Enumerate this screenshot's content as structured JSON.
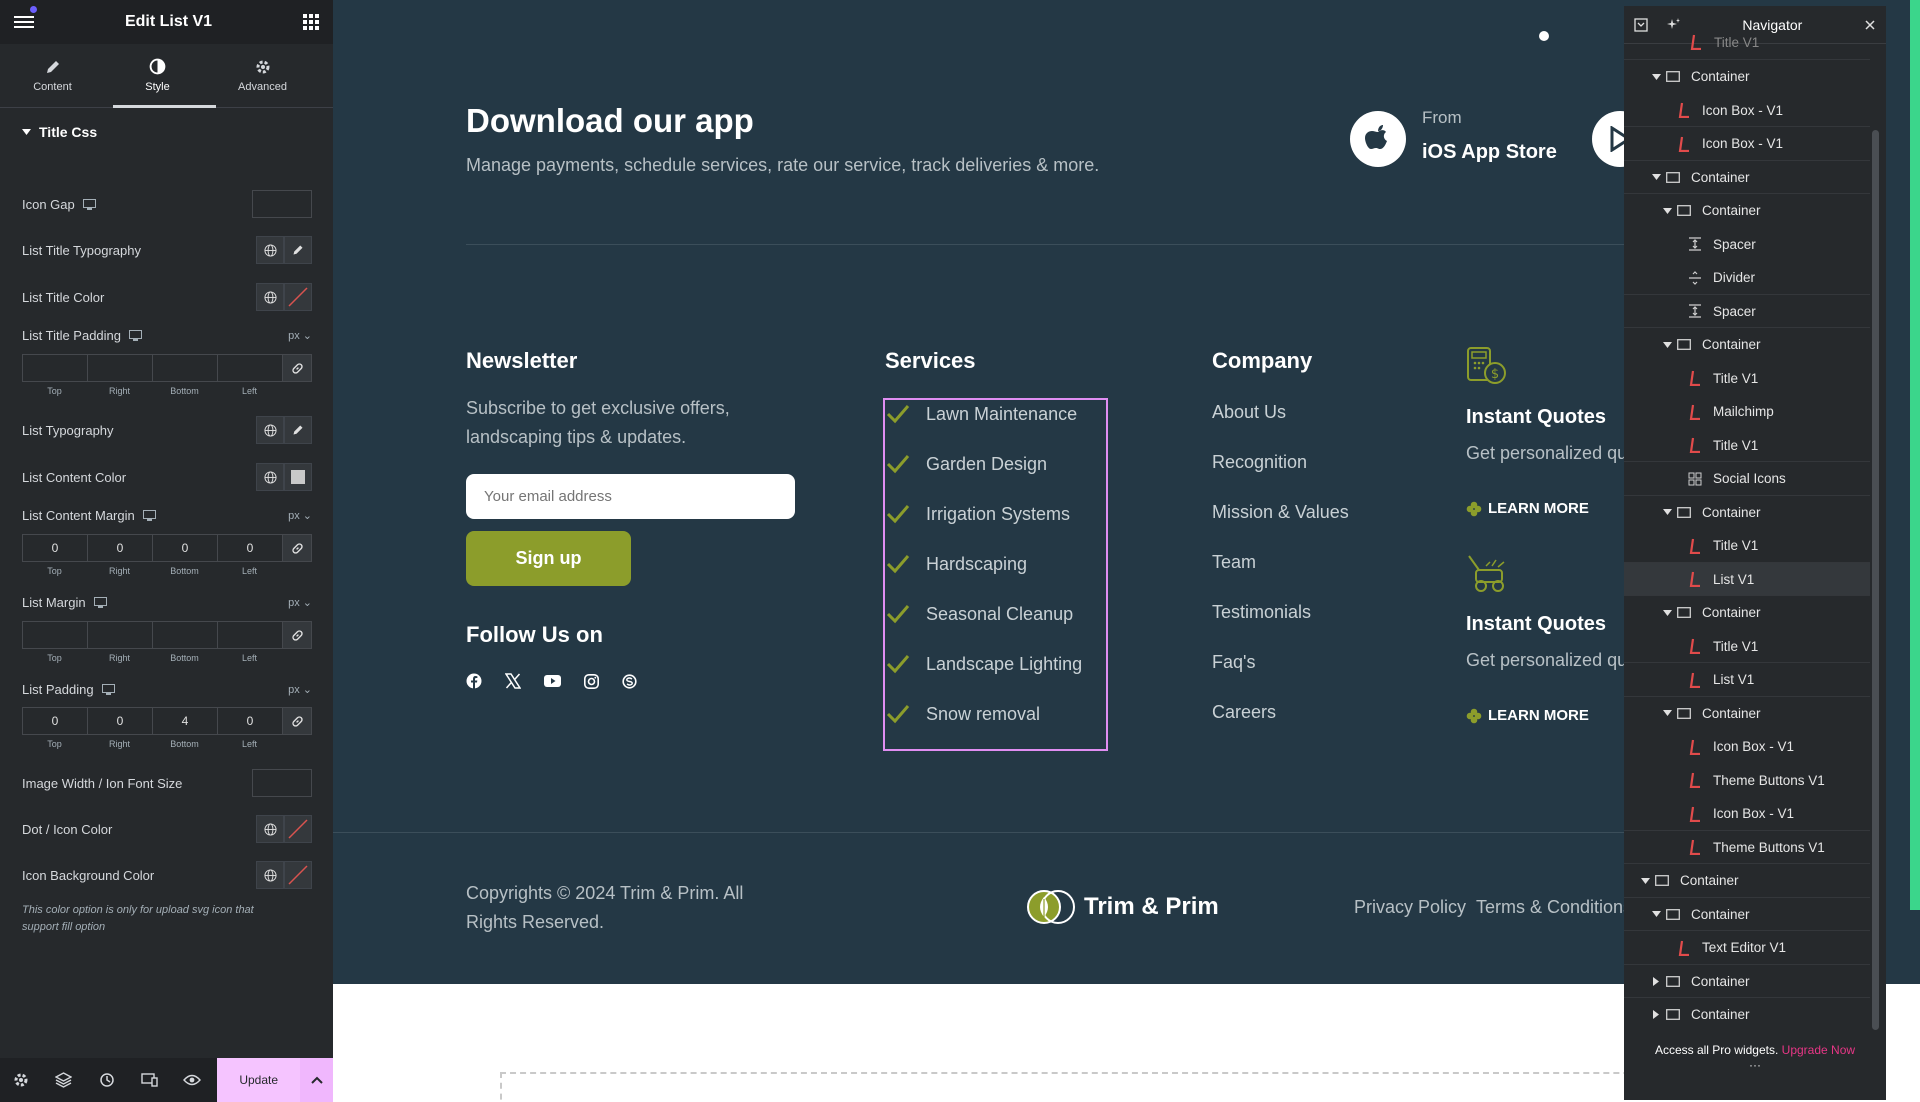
{
  "editor": {
    "title": "Edit List V1",
    "tabs": [
      {
        "label": "Content",
        "icon": "pencil-icon"
      },
      {
        "label": "Style",
        "icon": "contrast-icon"
      },
      {
        "label": "Advanced",
        "icon": "gear-icon"
      }
    ],
    "section_title": "Title Css",
    "controls": {
      "icon_gap": "Icon Gap",
      "list_title_typography": "List Title Typography",
      "list_title_color": "List Title Color",
      "list_title_padding": "List Title Padding",
      "list_typography": "List Typography",
      "list_content_color": "List Content Color",
      "list_content_margin": "List Content Margin",
      "list_margin": "List Margin",
      "list_padding": "List Padding",
      "image_width": "Image Width / Ion Font Size",
      "dot_icon_color": "Dot / Icon Color",
      "icon_bg_color": "Icon Background Color"
    },
    "unit": "px",
    "dim_labels": [
      "Top",
      "Right",
      "Bottom",
      "Left"
    ],
    "title_padding_values": [
      "",
      "",
      "",
      ""
    ],
    "content_margin_values": [
      "0",
      "0",
      "0",
      "0"
    ],
    "list_margin_values": [
      "",
      "",
      "",
      ""
    ],
    "list_padding_values": [
      "0",
      "0",
      "4",
      "0"
    ],
    "note": "This color option is only for upload svg icon that support fill option",
    "update_label": "Update"
  },
  "site": {
    "app": {
      "title": "Download our app",
      "subtitle": "Manage payments, schedule services, rate our service, track deliveries & more.",
      "store_from": "From",
      "store_name": "iOS App Store"
    },
    "newsletter": {
      "title": "Newsletter",
      "text": "Subscribe to get exclusive offers, landscaping tips & updates.",
      "placeholder": "Your email address",
      "button": "Sign up",
      "follow": "Follow Us on"
    },
    "services": {
      "title": "Services",
      "items": [
        "Lawn Maintenance",
        "Garden Design",
        "Irrigation Systems",
        "Hardscaping",
        "Seasonal Cleanup",
        "Landscape Lighting",
        "Snow removal"
      ]
    },
    "company": {
      "title": "Company",
      "items": [
        "About Us",
        "Recognition",
        "Mission & Values",
        "Team",
        "Testimonials",
        "Faq's",
        "Careers"
      ]
    },
    "quotes": [
      {
        "title": "Instant Quotes",
        "text": "Get personalized qu",
        "link": "LEARN MORE"
      },
      {
        "title": "Instant Quotes",
        "text": "Get personalized qu",
        "link": "LEARN MORE"
      }
    ],
    "footer": {
      "copyright": "Copyrights © 2024 Trim & Prim. All Rights Reserved.",
      "logo": "Trim & Prim",
      "privacy": "Privacy Policy",
      "terms": "Terms & Conditions"
    },
    "colors": {
      "bg": "#243845",
      "accent": "#8c9d2b",
      "highlight": "#e08ef2"
    }
  },
  "navigator": {
    "title": "Navigator",
    "clipped_top": "Title V1",
    "items": [
      {
        "label": "Container",
        "type": "container",
        "expanded": true
      },
      {
        "label": "Icon Box - V1",
        "type": "widget"
      },
      {
        "label": "Icon Box - V1",
        "type": "widget"
      },
      {
        "label": "Container",
        "type": "container",
        "expanded": true
      },
      {
        "label": "Container",
        "type": "container",
        "expanded": true
      },
      {
        "label": "Spacer",
        "type": "spacer"
      },
      {
        "label": "Divider",
        "type": "divider"
      },
      {
        "label": "Spacer",
        "type": "spacer"
      },
      {
        "label": "Container",
        "type": "container",
        "expanded": true
      },
      {
        "label": "Title V1",
        "type": "widget"
      },
      {
        "label": "Mailchimp",
        "type": "widget"
      },
      {
        "label": "Title V1",
        "type": "widget"
      },
      {
        "label": "Social Icons",
        "type": "social"
      },
      {
        "label": "Container",
        "type": "container",
        "expanded": true
      },
      {
        "label": "Title V1",
        "type": "widget"
      },
      {
        "label": "List V1",
        "type": "widget",
        "selected": true
      },
      {
        "label": "Container",
        "type": "container",
        "expanded": true
      },
      {
        "label": "Title V1",
        "type": "widget"
      },
      {
        "label": "List V1",
        "type": "widget"
      },
      {
        "label": "Container",
        "type": "container",
        "expanded": true
      },
      {
        "label": "Icon Box - V1",
        "type": "widget"
      },
      {
        "label": "Theme Buttons V1",
        "type": "widget"
      },
      {
        "label": "Icon Box - V1",
        "type": "widget"
      },
      {
        "label": "Theme Buttons V1",
        "type": "widget"
      },
      {
        "label": "Container",
        "type": "container",
        "expanded": true
      },
      {
        "label": "Container",
        "type": "container",
        "expanded": true
      },
      {
        "label": "Text Editor V1",
        "type": "widget"
      },
      {
        "label": "Container",
        "type": "container",
        "expanded": false
      },
      {
        "label": "Container",
        "type": "container",
        "expanded": false
      }
    ],
    "footer_text": "Access all Pro widgets.",
    "footer_link": "Upgrade Now"
  }
}
